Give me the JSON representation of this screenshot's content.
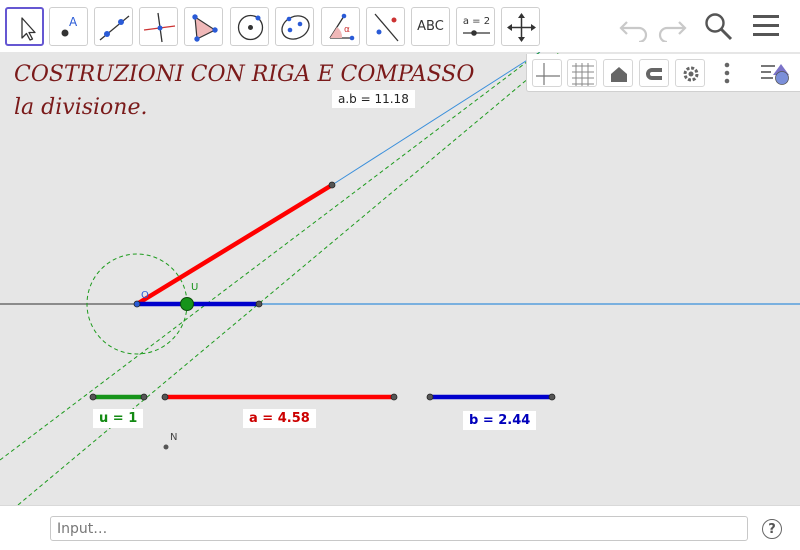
{
  "toolbar": {
    "tools": [
      {
        "name": "move-tool",
        "icon": "arrow-cursor-icon",
        "active": true
      },
      {
        "name": "point-tool",
        "icon": "point-icon",
        "label": "A"
      },
      {
        "name": "line-tool",
        "icon": "line-through-points-icon"
      },
      {
        "name": "perpendicular-line-tool",
        "icon": "perpendicular-line-icon"
      },
      {
        "name": "polygon-tool",
        "icon": "polygon-icon"
      },
      {
        "name": "circle-tool",
        "icon": "circle-center-point-icon"
      },
      {
        "name": "conic-tool",
        "icon": "ellipse-icon"
      },
      {
        "name": "angle-tool",
        "icon": "angle-icon",
        "label": "α"
      },
      {
        "name": "reflect-tool",
        "icon": "reflect-about-line-icon"
      },
      {
        "name": "text-tool",
        "label": "ABC"
      },
      {
        "name": "slider-tool",
        "label": "a = 2"
      },
      {
        "name": "move-view-tool",
        "icon": "move-graphics-view-icon"
      }
    ],
    "undo_icon": "undo-icon",
    "redo_icon": "redo-icon",
    "search_icon": "search-icon",
    "menu_icon": "hamburger-menu-icon"
  },
  "stylebar": {
    "buttons": [
      "axes-icon",
      "grid-icon",
      "home-icon",
      "point-capturing-icon",
      "gear-icon",
      "more-icon",
      "style-toggle-icon"
    ]
  },
  "canvas": {
    "title_line1": "COSTRUZIONI CON RIGA E COMPASSO",
    "title_line2": "la  divisione.",
    "label_ab": "a.b  =  11.18",
    "label_u": "u  =  1",
    "label_a": "a  =  4.58",
    "label_b": "b  =  2.44",
    "point_o": "O",
    "point_u": "U",
    "point_n": "N",
    "colors": {
      "red": "#ff0000",
      "blue": "#0000cc",
      "green": "#16941a",
      "blue_line": "#3a8fdb",
      "dashed": "#1e9b1e",
      "title": "#7a1a1a"
    }
  },
  "input": {
    "placeholder": "Input…"
  },
  "help_label": "?"
}
